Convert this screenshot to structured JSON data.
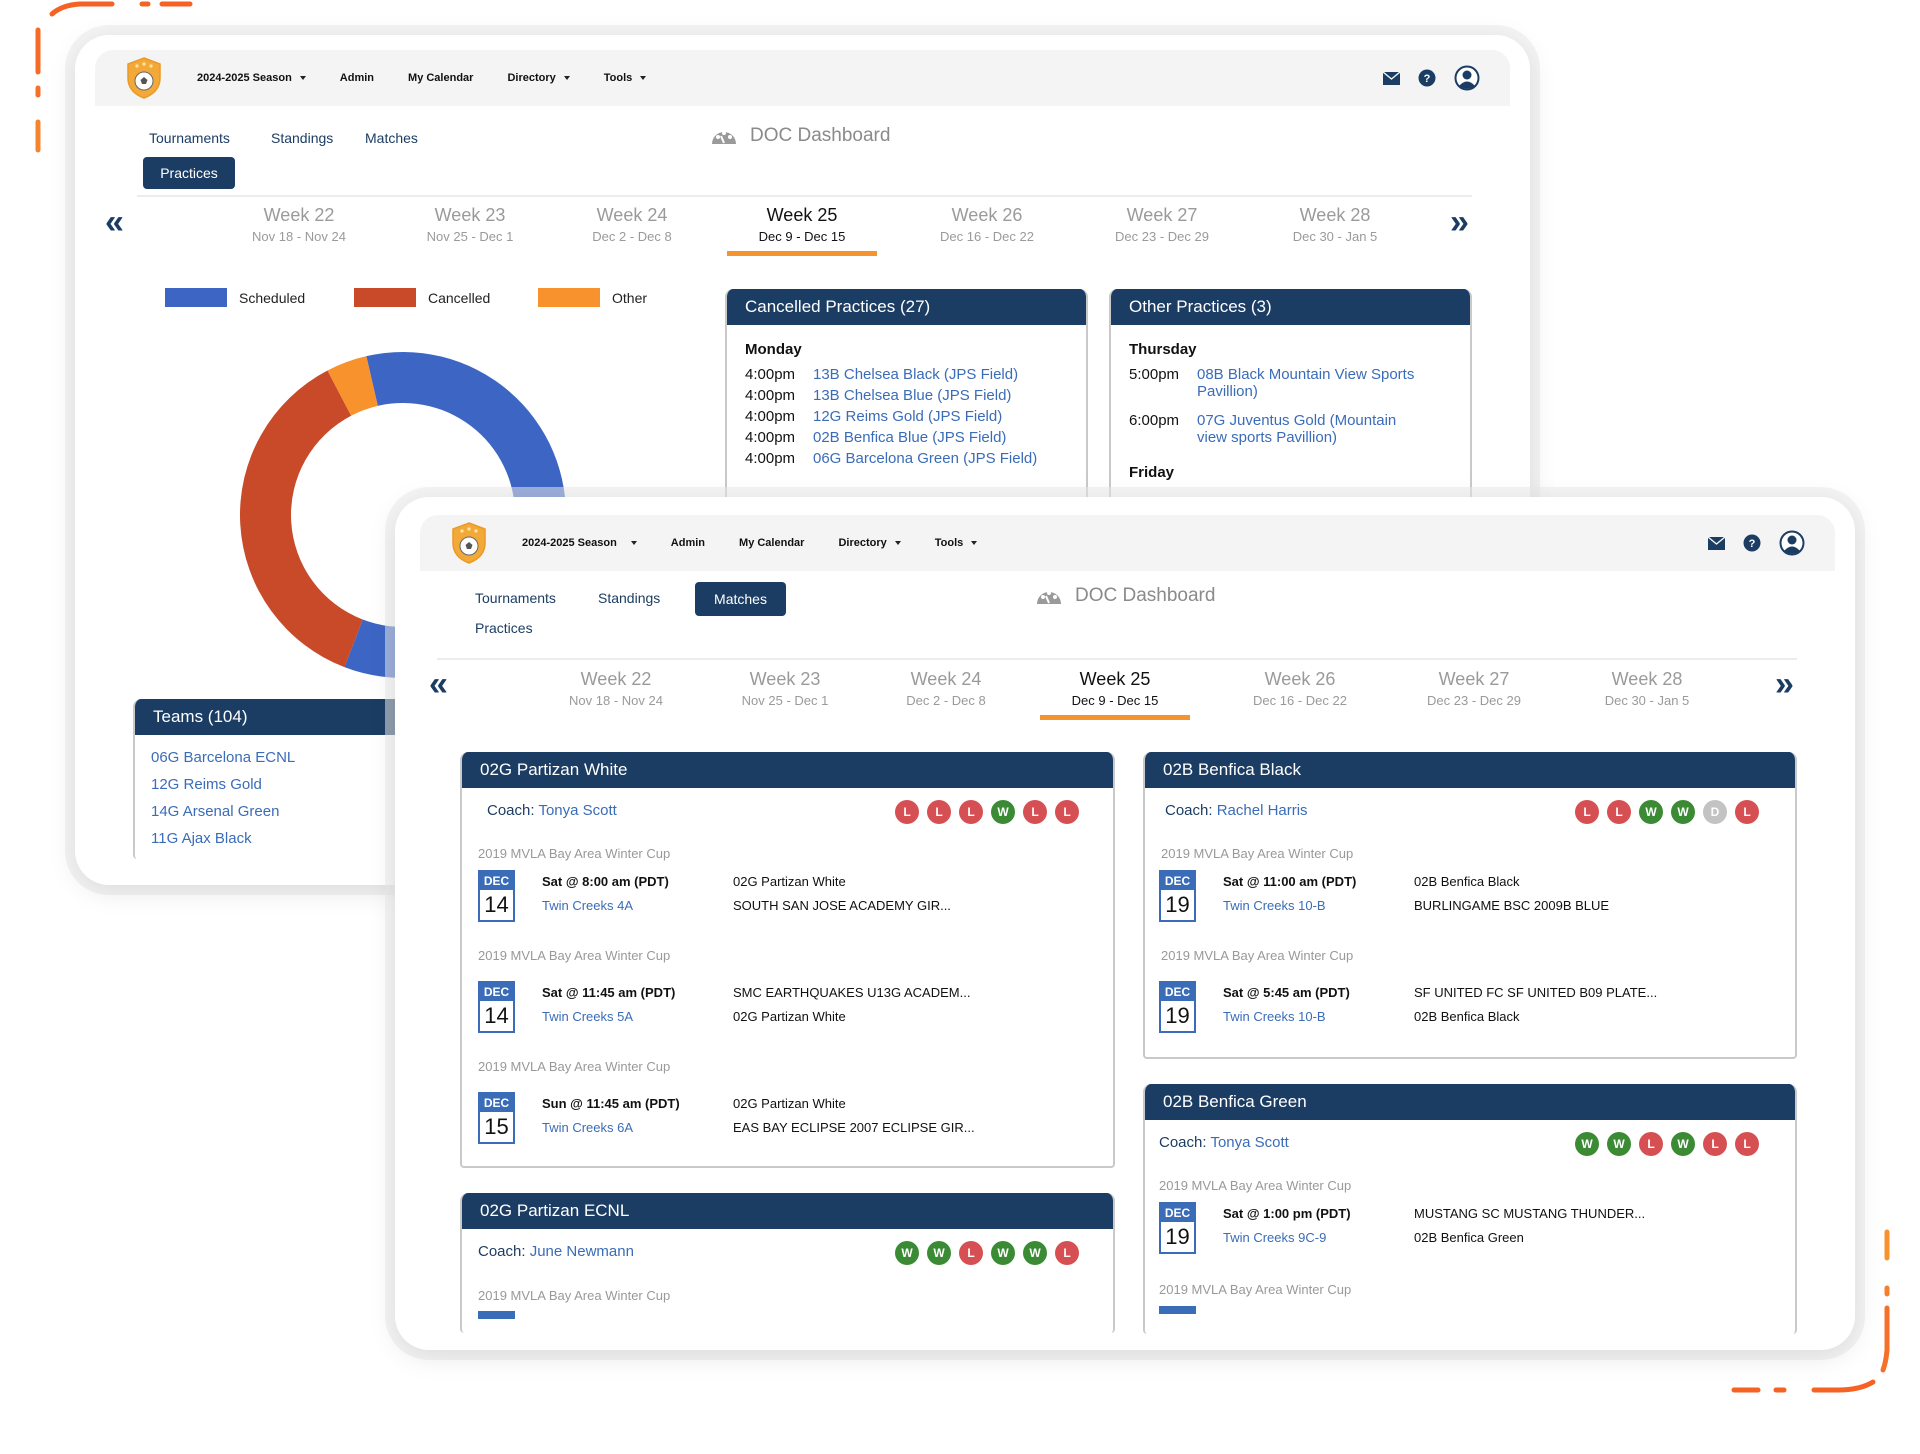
{
  "nav": {
    "season": "2024-2025 Season",
    "admin": "Admin",
    "my_calendar": "My Calendar",
    "directory": "Directory",
    "tools": "Tools"
  },
  "icons": {
    "mail": "mail-icon",
    "help": "help-icon",
    "user": "user-icon",
    "help_glyph": "?"
  },
  "subnav": {
    "tournaments": "Tournaments",
    "standings": "Standings",
    "matches": "Matches",
    "practices": "Practices"
  },
  "dashboard_title": "DOC Dashboard",
  "weeks": [
    {
      "label": "Week 22",
      "range": "Nov 18 - Nov 24",
      "active": false
    },
    {
      "label": "Week 23",
      "range": "Nov 25 - Dec 1",
      "active": false
    },
    {
      "label": "Week 24",
      "range": "Dec 2 - Dec 8",
      "active": false
    },
    {
      "label": "Week 25",
      "range": "Dec 9 - Dec 15",
      "active": true
    },
    {
      "label": "Week 26",
      "range": "Dec 16 - Dec 22",
      "active": false
    },
    {
      "label": "Week 27",
      "range": "Dec 23 - Dec 29",
      "active": false
    },
    {
      "label": "Week 28",
      "range": "Dec 30 - Jan 5",
      "active": false
    }
  ],
  "colors": {
    "navy": "#1c3d63",
    "link": "#3a6cb8",
    "accent_orange": "#f5932f",
    "scheduled": "#3d65c4",
    "cancelled": "#c84a29",
    "other": "#f7922d",
    "loss": "#d64f53",
    "win": "#3b8b35",
    "draw": "#c3c3c3"
  },
  "chart_data": {
    "type": "pie",
    "variant": "donut",
    "legend": [
      "Scheduled",
      "Cancelled",
      "Other"
    ],
    "legend_position": "top",
    "categories": [
      "Scheduled",
      "Cancelled",
      "Other"
    ],
    "values": [
      44,
      27,
      3
    ],
    "title": ""
  },
  "cancelled_practices": {
    "title": "Cancelled Practices (27)",
    "days": [
      {
        "day": "Monday",
        "rows": [
          {
            "time": "4:00pm",
            "team": "13B Chelsea Black (JPS Field)"
          },
          {
            "time": "4:00pm",
            "team": "13B Chelsea Blue (JPS Field)"
          },
          {
            "time": "4:00pm",
            "team": "12G Reims Gold (JPS Field)"
          },
          {
            "time": "4:00pm",
            "team": "02B Benfica Blue (JPS Field)"
          },
          {
            "time": "4:00pm",
            "team": "06G Barcelona Green (JPS Field)"
          }
        ]
      }
    ]
  },
  "other_practices": {
    "title": "Other Practices (3)",
    "days": [
      {
        "day": "Thursday",
        "rows": [
          {
            "time": "5:00pm",
            "team": "08B Black Mountain View Sports Pavillion)"
          },
          {
            "time": "6:00pm",
            "team": "07G Juventus Gold (Mountain view sports Pavillion)"
          }
        ]
      },
      {
        "day": "Friday",
        "rows": []
      }
    ]
  },
  "teams": {
    "title": "Teams (104)",
    "items": [
      "06G Barcelona ECNL",
      "12G Reims Gold",
      "14G Arsenal Green",
      "11G Ajax Black"
    ]
  },
  "match_cards": [
    {
      "team": "02G Partizan White",
      "coach_label": "Coach:",
      "coach": "Tonya Scott",
      "results": [
        "L",
        "L",
        "L",
        "W",
        "L",
        "L"
      ],
      "matches": [
        {
          "cup": "2019 MVLA Bay Area Winter Cup",
          "month": "DEC",
          "day": "14",
          "time": "Sat @ 8:00 am (PDT)",
          "location": "Twin Creeks 4A",
          "home": "02G Partizan White",
          "away": "SOUTH SAN JOSE ACADEMY GIR..."
        },
        {
          "cup": "2019 MVLA Bay Area Winter Cup",
          "month": "DEC",
          "day": "14",
          "time": "Sat @ 11:45 am (PDT)",
          "location": "Twin Creeks 5A",
          "home": "SMC EARTHQUAKES U13G ACADEM...",
          "away": "02G Partizan White"
        },
        {
          "cup": "2019 MVLA Bay Area Winter Cup",
          "month": "DEC",
          "day": "15",
          "time": "Sun @ 11:45 am (PDT)",
          "location": "Twin Creeks 6A",
          "home": "02G Partizan White",
          "away": "EAS BAY ECLIPSE 2007 ECLIPSE GIR..."
        }
      ]
    },
    {
      "team": "02G Partizan ECNL",
      "coach_label": "Coach:",
      "coach": "June Newmann",
      "results": [
        "W",
        "W",
        "L",
        "W",
        "W",
        "L"
      ],
      "matches": [
        {
          "cup": "2019 MVLA Bay Area Winter Cup"
        }
      ]
    },
    {
      "team": "02B Benfica Black",
      "coach_label": "Coach:",
      "coach": "Rachel Harris",
      "results": [
        "L",
        "L",
        "W",
        "W",
        "D",
        "L"
      ],
      "matches": [
        {
          "cup": "2019 MVLA Bay Area Winter Cup",
          "month": "DEC",
          "day": "19",
          "time": "Sat @ 11:00 am (PDT)",
          "location": "Twin Creeks 10-B",
          "home": "02B Benfica Black",
          "away": "BURLINGAME BSC 2009B BLUE"
        },
        {
          "cup": "2019 MVLA Bay Area Winter Cup",
          "month": "DEC",
          "day": "19",
          "time": "Sat @ 5:45 am (PDT)",
          "location": "Twin Creeks 10-B",
          "home": "SF UNITED FC SF UNITED B09 PLATE...",
          "away": "02B Benfica Black"
        }
      ]
    },
    {
      "team": "02B Benfica Green",
      "coach_label": "Coach:",
      "coach": "Tonya Scott",
      "results": [
        "W",
        "W",
        "L",
        "W",
        "L",
        "L"
      ],
      "matches": [
        {
          "cup": "2019 MVLA Bay Area Winter Cup",
          "month": "DEC",
          "day": "19",
          "time": "Sat @ 1:00 pm (PDT)",
          "location": "Twin Creeks 9C-9",
          "home": "MUSTANG SC MUSTANG THUNDER...",
          "away": "02B Benfica Green"
        },
        {
          "cup": "2019 MVLA Bay Area Winter Cup"
        }
      ]
    }
  ]
}
